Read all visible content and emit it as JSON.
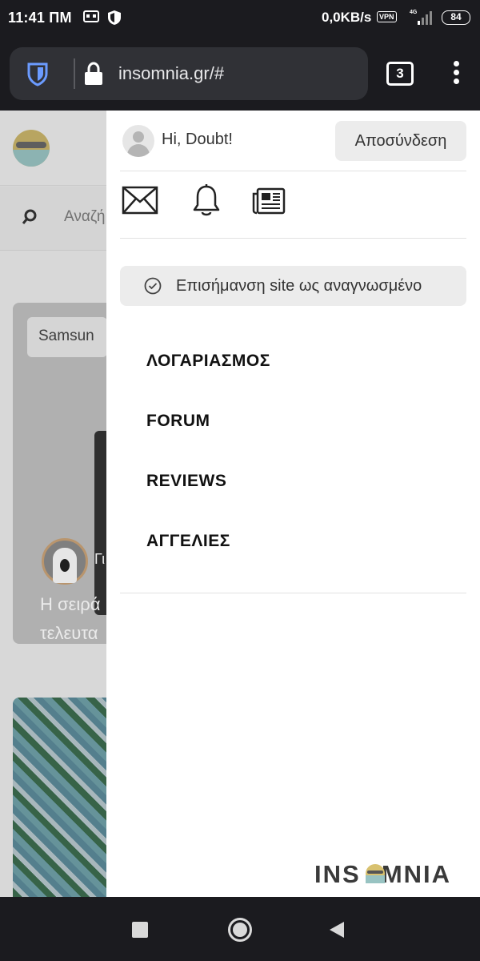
{
  "status_bar": {
    "time": "11:41 ΠΜ",
    "net_speed": "0,0KB/s",
    "vpn_label": "VPN",
    "network_type": "4G",
    "battery": "84"
  },
  "browser": {
    "url": "insomnia.gr/#",
    "tab_count": "3"
  },
  "background_page": {
    "search_placeholder": "Αναζή",
    "card_tag": "Samsun",
    "author_initial": "Γι",
    "headline_line1": "Η σειρά",
    "headline_line2": "τελευτα"
  },
  "drawer": {
    "greeting": "Hi, Doubt!",
    "logout_label": "Αποσύνδεση",
    "mark_read_label": "Επισήμανση site ως αναγνωσμένο",
    "nav_items": [
      "ΛΟΓΑΡΙΑΣΜΟΣ",
      "FORUM",
      "REVIEWS",
      "ΑΓΓΕΛΙΕΣ"
    ],
    "brand_logo_text": "INSOMNIA"
  },
  "colors": {
    "chrome_bg": "#1b1b1f",
    "url_box": "#303136",
    "drawer_bg": "#ffffff",
    "button_bg": "#ececec",
    "brand_dark": "#3a3a3a",
    "brand_mask": "#98c3c2"
  },
  "icons": [
    "vr-headset-icon",
    "shield-status-icon",
    "signal-icon",
    "battery-icon",
    "bitwarden-shield-icon",
    "lock-icon",
    "tabs-icon",
    "more-vertical-icon",
    "search-icon",
    "user-avatar-icon",
    "mail-icon",
    "bell-icon",
    "newspaper-icon",
    "check-circle-icon",
    "recents-icon",
    "home-icon",
    "back-icon"
  ]
}
